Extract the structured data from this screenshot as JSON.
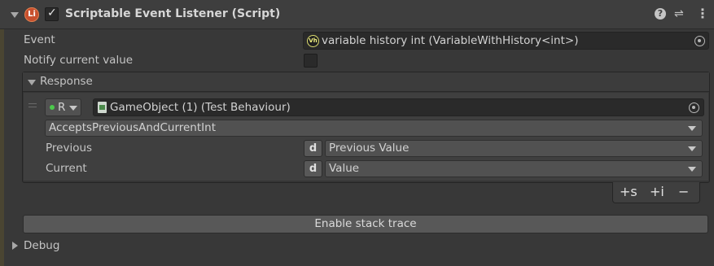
{
  "component": {
    "title": "Scriptable Event Listener (Script)",
    "enabled": true,
    "logo_text": "Li"
  },
  "fields": {
    "event_label": "Event",
    "event_value": "variable history int (VariableWithHistory<int>)",
    "event_icon_text": "Vh",
    "notify_label": "Notify current value",
    "notify_checked": false
  },
  "response": {
    "label": "Response",
    "runtime_mode": "R",
    "target_object": "GameObject (1) (Test Behaviour)",
    "method": "AcceptsPreviousAndCurrentInt",
    "params": [
      {
        "label": "Previous",
        "badge": "d",
        "value": "Previous Value"
      },
      {
        "label": "Current",
        "badge": "d",
        "value": "Value"
      }
    ],
    "buttons": {
      "add_static": "+s",
      "add_dynamic": "+i",
      "remove": "−"
    }
  },
  "footer": {
    "stack_trace_button": "Enable stack trace",
    "debug_label": "Debug"
  },
  "colors": {
    "background": "#383838",
    "header": "#3e3e3e",
    "field": "#2a2a2a",
    "dropdown": "#515151",
    "text": "#c4c4c4"
  }
}
